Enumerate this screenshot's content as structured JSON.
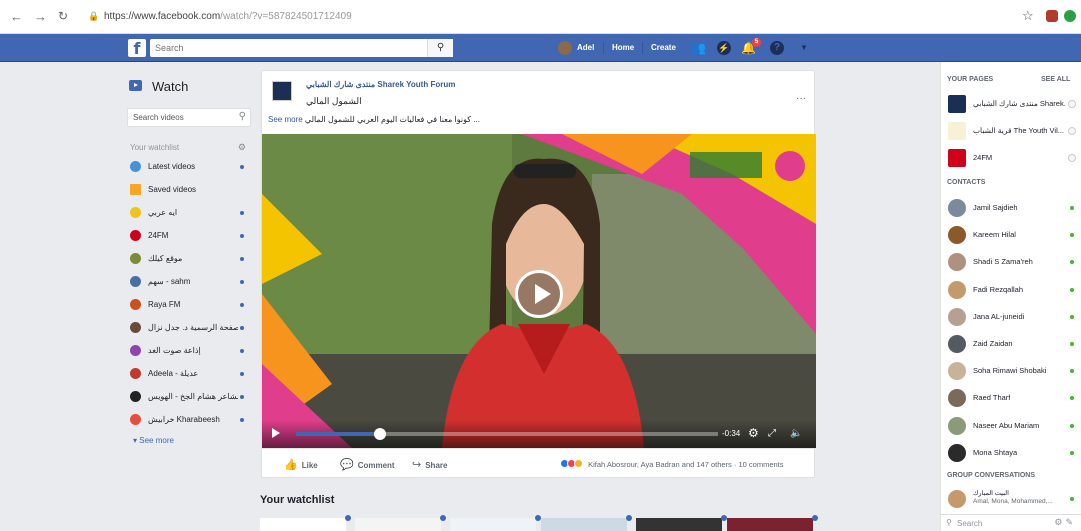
{
  "browser": {
    "url_main": "https://www.facebook.com",
    "url_rest": "/watch/?v=587824501712409"
  },
  "topbar": {
    "search_placeholder": "Search",
    "user_name": "Adel",
    "home": "Home",
    "create": "Create",
    "notification_count": "5"
  },
  "left": {
    "title": "Watch",
    "search_placeholder": "Search videos",
    "watchlist_header": "Your watchlist",
    "items": [
      {
        "label": "Latest videos",
        "color": "#4a90d9",
        "dot": true
      },
      {
        "label": "Saved videos",
        "color": "#f5a623",
        "dot": false
      },
      {
        "label": "ايه عربي",
        "color": "#f0c419",
        "dot": true
      },
      {
        "label": "24FM",
        "color": "#d0021b",
        "dot": true
      },
      {
        "label": "موقع كيلك",
        "color": "#7a8b3c",
        "dot": true
      },
      {
        "label": "سهم - sahm",
        "color": "#4a6fa5",
        "dot": true
      },
      {
        "label": "Raya FM",
        "color": "#c8511d",
        "dot": true
      },
      {
        "label": "صفحة الرسمية د. جدل نزال",
        "color": "#6a4a3a",
        "dot": true
      },
      {
        "label": "إذاعة صوت الغد",
        "color": "#8e44ad",
        "dot": true
      },
      {
        "label": "Adeela - عديلة",
        "color": "#c0392b",
        "dot": true
      },
      {
        "label": "الشاعر هشام الجخ - الهويس",
        "color": "#222222",
        "dot": true
      },
      {
        "label": "خرابيش Kharabeesh",
        "color": "#e74c3c",
        "dot": true
      }
    ],
    "see_more": "See more"
  },
  "post": {
    "page_name": "منتدى شارك الشبابي Sharek Youth Forum",
    "title": "الشمول المالي",
    "description": "كونوا معنا في فعاليات اليوم العربي للشمول المالي ...",
    "see_more": "See more",
    "video_time": "-0:34",
    "video_progress": 0.2,
    "actions": {
      "like": "Like",
      "comment": "Comment",
      "share": "Share"
    },
    "reactions_text": "Kifah Abosrour, Aya Badran and 147 others · 10 comments"
  },
  "your_watchlist": "Your watchlist",
  "right": {
    "your_pages": "YOUR PAGES",
    "see_all": "SEE ALL",
    "pages": [
      {
        "name": "منتدى شارك الشبابي Sharek...",
        "color": "#1b2f55"
      },
      {
        "name": "قرية الشباب The Youth Vil...",
        "color": "#f7f1d6"
      },
      {
        "name": "24FM",
        "color": "#d0021b"
      }
    ],
    "contacts_header": "CONTACTS",
    "contacts": [
      {
        "name": "Jamil Sajdieh",
        "color": "#7b8a9c"
      },
      {
        "name": "Kareem Hilal",
        "color": "#8b5a2b"
      },
      {
        "name": "Shadi S Zama'reh",
        "color": "#b09080"
      },
      {
        "name": "Fadi Rezqallah",
        "color": "#c49a6c"
      },
      {
        "name": "Jana AL-juneidi",
        "color": "#b8a090"
      },
      {
        "name": "Zaid Zaidan",
        "color": "#555a60"
      },
      {
        "name": "Soha Rimawi Shobaki",
        "color": "#c7b29a"
      },
      {
        "name": "Raed Tharf",
        "color": "#7a6a5a"
      },
      {
        "name": "Naseer Abu Mariam",
        "color": "#8a9a7a"
      },
      {
        "name": "Mona Shtaya",
        "color": "#2a2a2a"
      }
    ],
    "group_header": "GROUP CONVERSATIONS",
    "group": {
      "title": "البيت المبارك",
      "members": "Amal, Mona, Mohammed,..."
    },
    "search_placeholder": "Search"
  }
}
